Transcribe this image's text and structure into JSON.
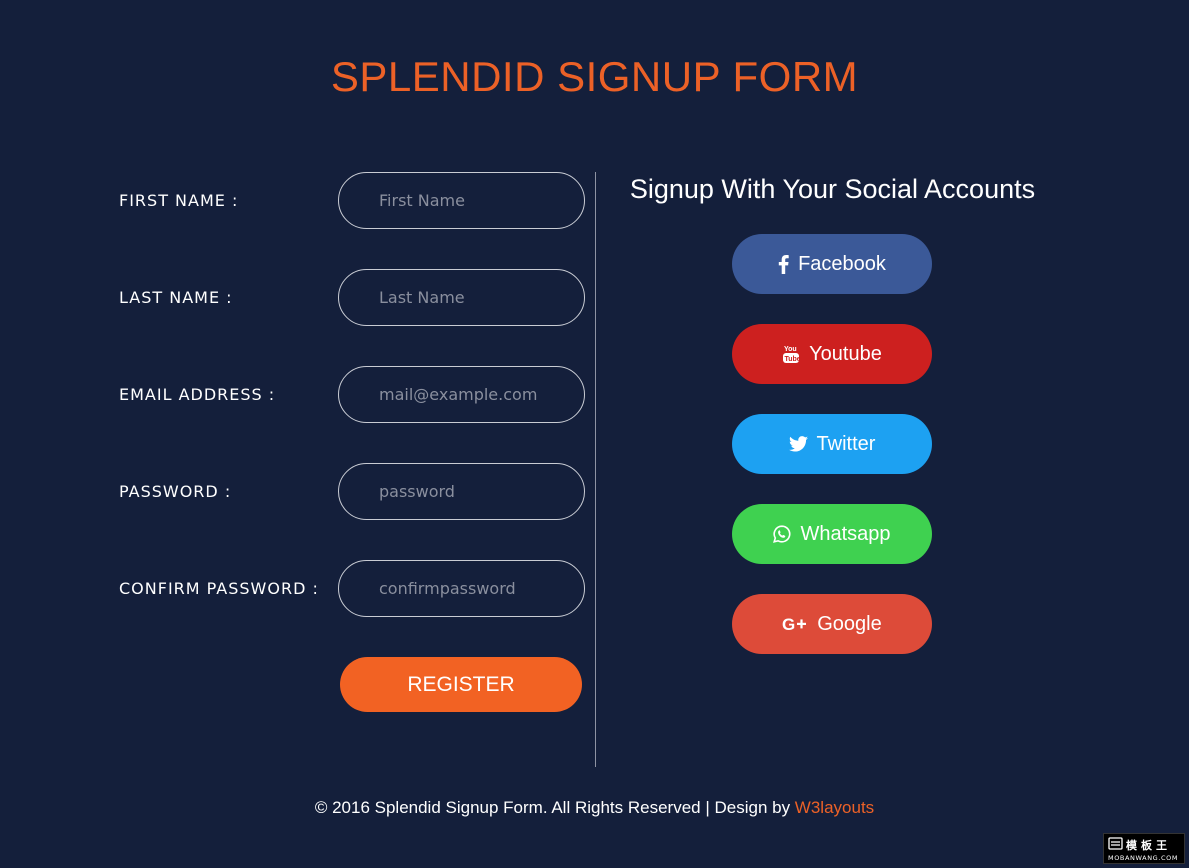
{
  "page": {
    "title": "SPLENDID SIGNUP FORM"
  },
  "form": {
    "fields": [
      {
        "label": "FIRST NAME :",
        "placeholder": "First Name",
        "value": ""
      },
      {
        "label": "LAST NAME :",
        "placeholder": "Last Name",
        "value": ""
      },
      {
        "label": "EMAIL ADDRESS :",
        "placeholder": "mail@example.com",
        "value": ""
      },
      {
        "label": "PASSWORD :",
        "placeholder": "password",
        "value": ""
      },
      {
        "label": "CONFIRM PASSWORD :",
        "placeholder": "confirmpassword",
        "value": ""
      }
    ],
    "register_label": "REGISTER"
  },
  "social": {
    "title": "Signup With Your Social Accounts",
    "buttons": [
      {
        "label": "Facebook",
        "icon": "facebook-icon",
        "color": "#3b5998"
      },
      {
        "label": "Youtube",
        "icon": "youtube-icon",
        "color": "#cd201f"
      },
      {
        "label": "Twitter",
        "icon": "twitter-icon",
        "color": "#1da1f2"
      },
      {
        "label": "Whatsapp",
        "icon": "whatsapp-icon",
        "color": "#3fd150"
      },
      {
        "label": "Google",
        "icon": "google-plus-icon",
        "color": "#dd4b39"
      }
    ]
  },
  "footer": {
    "text": "© 2016 Splendid Signup Form. All Rights Reserved | Design by ",
    "link_text": "W3layouts",
    "link_color": "#ec6127"
  },
  "colors": {
    "background": "#141f3b",
    "accent": "#ec6127",
    "register": "#f26223"
  },
  "watermark": {
    "brand": "模板王",
    "site": "MOBANWANG.COM"
  }
}
